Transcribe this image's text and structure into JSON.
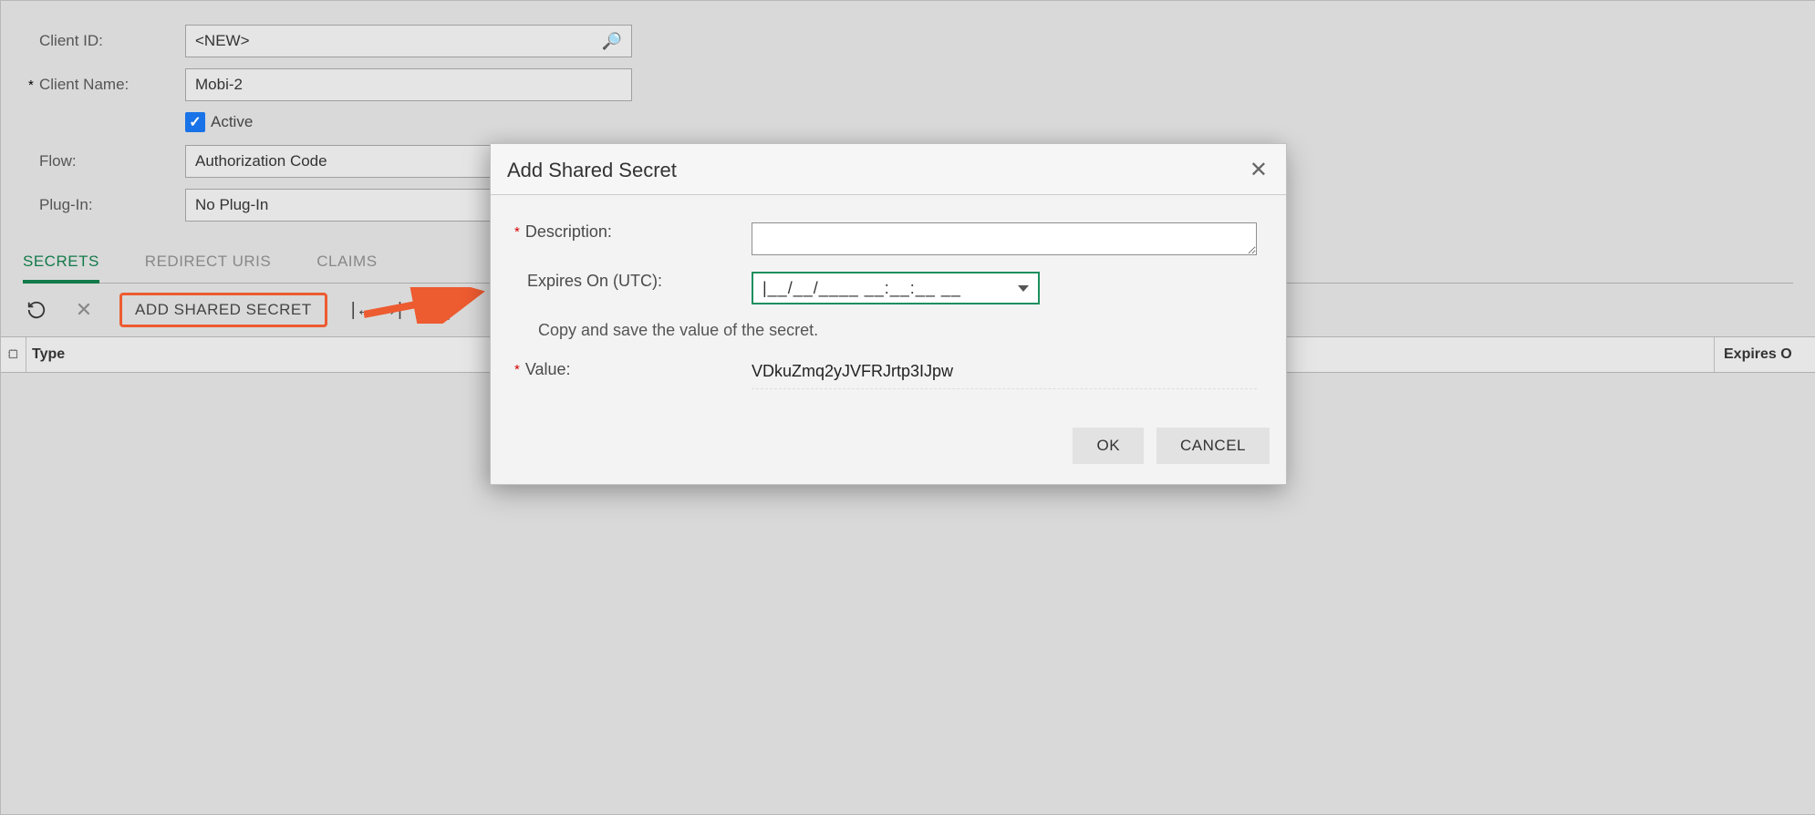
{
  "form": {
    "client_id_label": "Client ID:",
    "client_id_value": "<NEW>",
    "client_name_label": "Client Name:",
    "client_name_value": "Mobi-2",
    "active_label": "Active",
    "active_checked": true,
    "flow_label": "Flow:",
    "flow_value": "Authorization Code",
    "plugin_label": "Plug-In:",
    "plugin_value": "No Plug-In"
  },
  "tabs": [
    {
      "label": "SECRETS",
      "active": true
    },
    {
      "label": "REDIRECT URIS",
      "active": false
    },
    {
      "label": "CLAIMS",
      "active": false
    }
  ],
  "toolbar": {
    "add_shared_secret": "ADD SHARED SECRET"
  },
  "grid": {
    "col_type": "Type",
    "col_expires": "Expires O"
  },
  "modal": {
    "title": "Add Shared Secret",
    "description_label": "Description:",
    "description_value": "",
    "expires_label": "Expires On (UTC):",
    "expires_placeholder": "|__/__/____ __:__:__ __",
    "note": "Copy and save the value of the secret.",
    "value_label": "Value:",
    "value_text": "VDkuZmq2yJVFRJrtp3IJpw",
    "ok": "OK",
    "cancel": "CANCEL"
  }
}
